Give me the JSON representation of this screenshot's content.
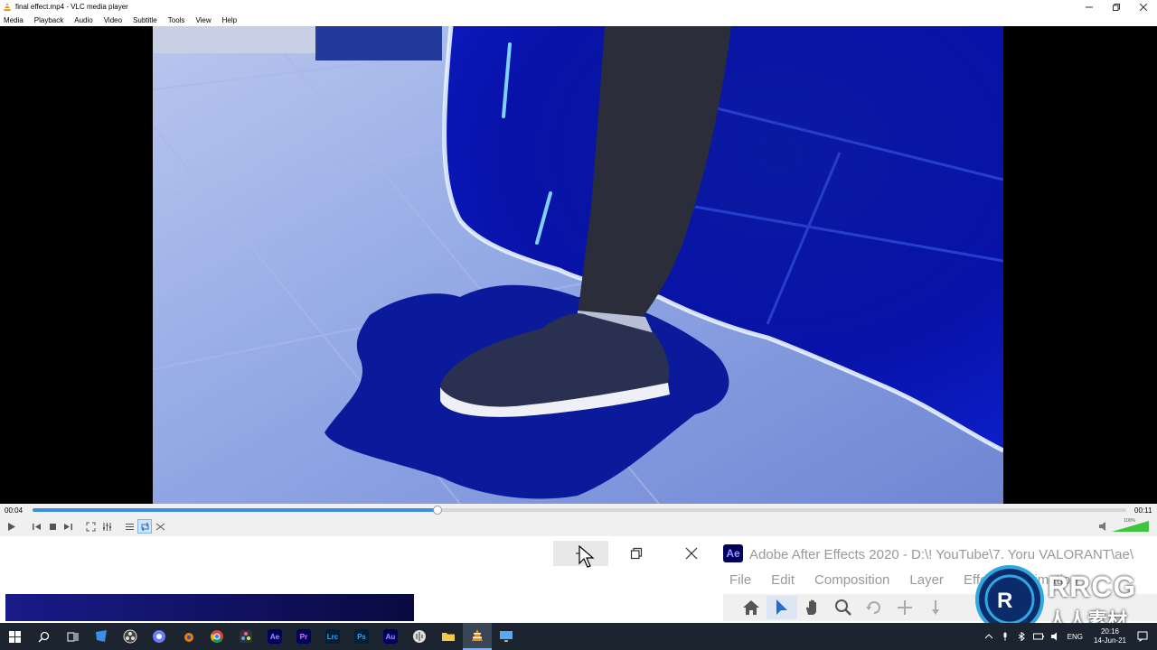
{
  "vlc": {
    "window_title": "final effect.mp4 - VLC media player",
    "menu": [
      "Media",
      "Playback",
      "Audio",
      "Video",
      "Subtitle",
      "Tools",
      "View",
      "Help"
    ],
    "time_elapsed": "00:04",
    "time_total": "00:11",
    "progress_fraction": 0.37,
    "volume_label": "100%",
    "volume_fraction": 1.0,
    "icons": [
      "play-icon",
      "prev-icon",
      "stop-icon",
      "next-icon",
      "fullscreen-icon",
      "extended-settings-icon",
      "playlist-icon",
      "loop-icon",
      "shuffle-icon",
      "volume-icon"
    ]
  },
  "ae": {
    "logo_text": "Ae",
    "title": "Adobe After Effects 2020 - D:\\! YouTube\\7. Yoru VALORANT\\ae\\",
    "menu": [
      "File",
      "Edit",
      "Composition",
      "Layer",
      "Effect",
      "Animation"
    ],
    "tools": [
      "home-icon",
      "selection-arrow-icon",
      "hand-icon",
      "zoom-icon",
      "rotate-icon",
      "anchor-icon",
      "pan-icon"
    ]
  },
  "taskbar": {
    "apps": [
      "Ae",
      "Pr",
      "Lrc",
      "Ps",
      "Au"
    ],
    "language": "ENG",
    "time": "20:16",
    "date": "14-Jun-21"
  },
  "watermark": {
    "text": "RRCG",
    "subtitle": "人人素材"
  },
  "colors": {
    "vlc_seek": "#3e8fe0",
    "ae_brand": "#00005b",
    "ae_brand_text": "#9999ff",
    "taskbar": "#1c2430"
  }
}
